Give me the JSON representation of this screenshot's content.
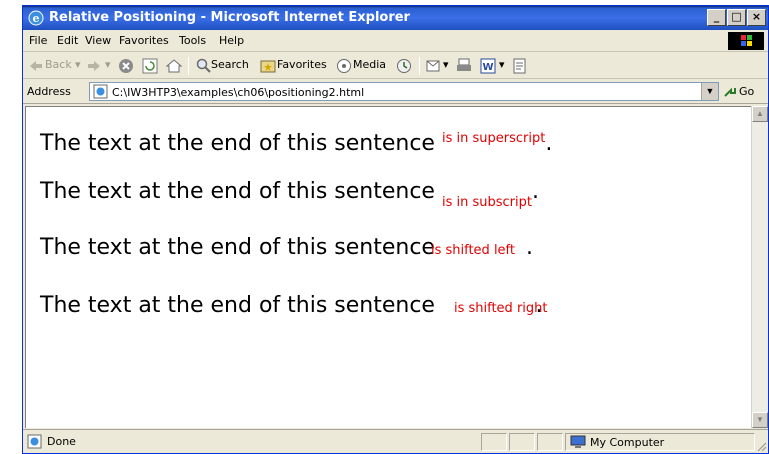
{
  "window": {
    "title": "Relative Positioning - Microsoft Internet Explorer",
    "controls": {
      "minimize": "_",
      "maximize": "□",
      "close": "×"
    }
  },
  "menu": {
    "items": [
      {
        "label": "File"
      },
      {
        "label": "Edit"
      },
      {
        "label": "View"
      },
      {
        "label": "Favorites"
      },
      {
        "label": "Tools"
      },
      {
        "label": "Help"
      }
    ]
  },
  "toolbar": {
    "back_label": "Back",
    "search_label": "Search",
    "favorites_label": "Favorites",
    "media_label": "Media"
  },
  "address": {
    "label": "Address",
    "value": "C:\\IW3HTP3\\examples\\ch06\\positioning2.html",
    "go_label": "Go"
  },
  "content": {
    "lines": [
      {
        "main": "The text at the end of this sentence",
        "span": "is in superscript",
        "tail": "."
      },
      {
        "main": "The text at the end of this sentence",
        "span": "is in subscript",
        "tail": "."
      },
      {
        "main": "The text at the end of this sentence",
        "span": "is shifted left",
        "tail": "."
      },
      {
        "main": "The text at the end of this sentence",
        "span": "is shifted right",
        "tail": "."
      }
    ],
    "span_color": "#e00000"
  },
  "status": {
    "text": "Done",
    "zone": "My Computer"
  },
  "colors": {
    "titlebar": "#2a5fd0",
    "chrome": "#ece9d8"
  }
}
